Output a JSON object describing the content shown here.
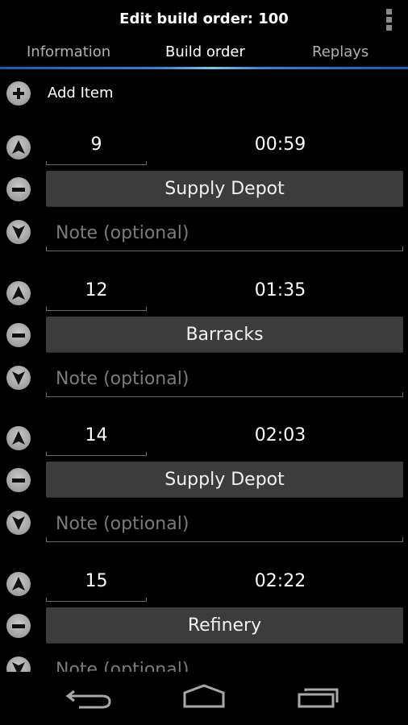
{
  "titlebar": {
    "title": "Edit build order: 100",
    "overflow_icon": "overflow-menu-icon"
  },
  "tabs": [
    {
      "label": "Information",
      "active": false
    },
    {
      "label": "Build order",
      "active": true
    },
    {
      "label": "Replays",
      "active": false
    }
  ],
  "add_item": {
    "label": "Add Item",
    "icon": "plus-circle-icon"
  },
  "items": [
    {
      "supply": "9",
      "time": "00:59",
      "unit": "Supply Depot",
      "note_placeholder": "Note (optional)",
      "note_value": ""
    },
    {
      "supply": "12",
      "time": "01:35",
      "unit": "Barracks",
      "note_placeholder": "Note (optional)",
      "note_value": ""
    },
    {
      "supply": "14",
      "time": "02:03",
      "unit": "Supply Depot",
      "note_placeholder": "Note (optional)",
      "note_value": ""
    },
    {
      "supply": "15",
      "time": "02:22",
      "unit": "Refinery",
      "note_placeholder": "Note (optional)",
      "note_value": ""
    }
  ],
  "navbar": {
    "back_icon": "back-icon",
    "home_icon": "home-icon",
    "recents_icon": "recent-apps-icon"
  },
  "colors": {
    "tab_indicator": "#3a84c9",
    "button_bg": "#3c3c3c",
    "background": "#000000"
  }
}
